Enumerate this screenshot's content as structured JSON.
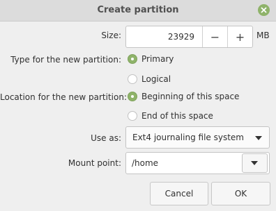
{
  "dialog": {
    "title": "Create partition"
  },
  "size": {
    "label": "Size:",
    "value": "23929",
    "decrement_label": "−",
    "increment_label": "+",
    "unit": "MB"
  },
  "type": {
    "label": "Type for the new partition:",
    "options": [
      {
        "label": "Primary",
        "selected": true
      },
      {
        "label": "Logical",
        "selected": false
      }
    ]
  },
  "location": {
    "label": "Location for the new partition:",
    "options": [
      {
        "label": "Beginning of this space",
        "selected": true
      },
      {
        "label": "End of this space",
        "selected": false
      }
    ]
  },
  "use_as": {
    "label": "Use as:",
    "selected": "Ext4 journaling file system"
  },
  "mount_point": {
    "label": "Mount point:",
    "value": "/home"
  },
  "buttons": {
    "cancel": "Cancel",
    "ok": "OK"
  },
  "colors": {
    "accent": "#8fb36a",
    "titlebar": "#dcdcdc"
  },
  "icons": {
    "close": "close-circle-icon",
    "dropdown": "chevron-down-icon"
  }
}
